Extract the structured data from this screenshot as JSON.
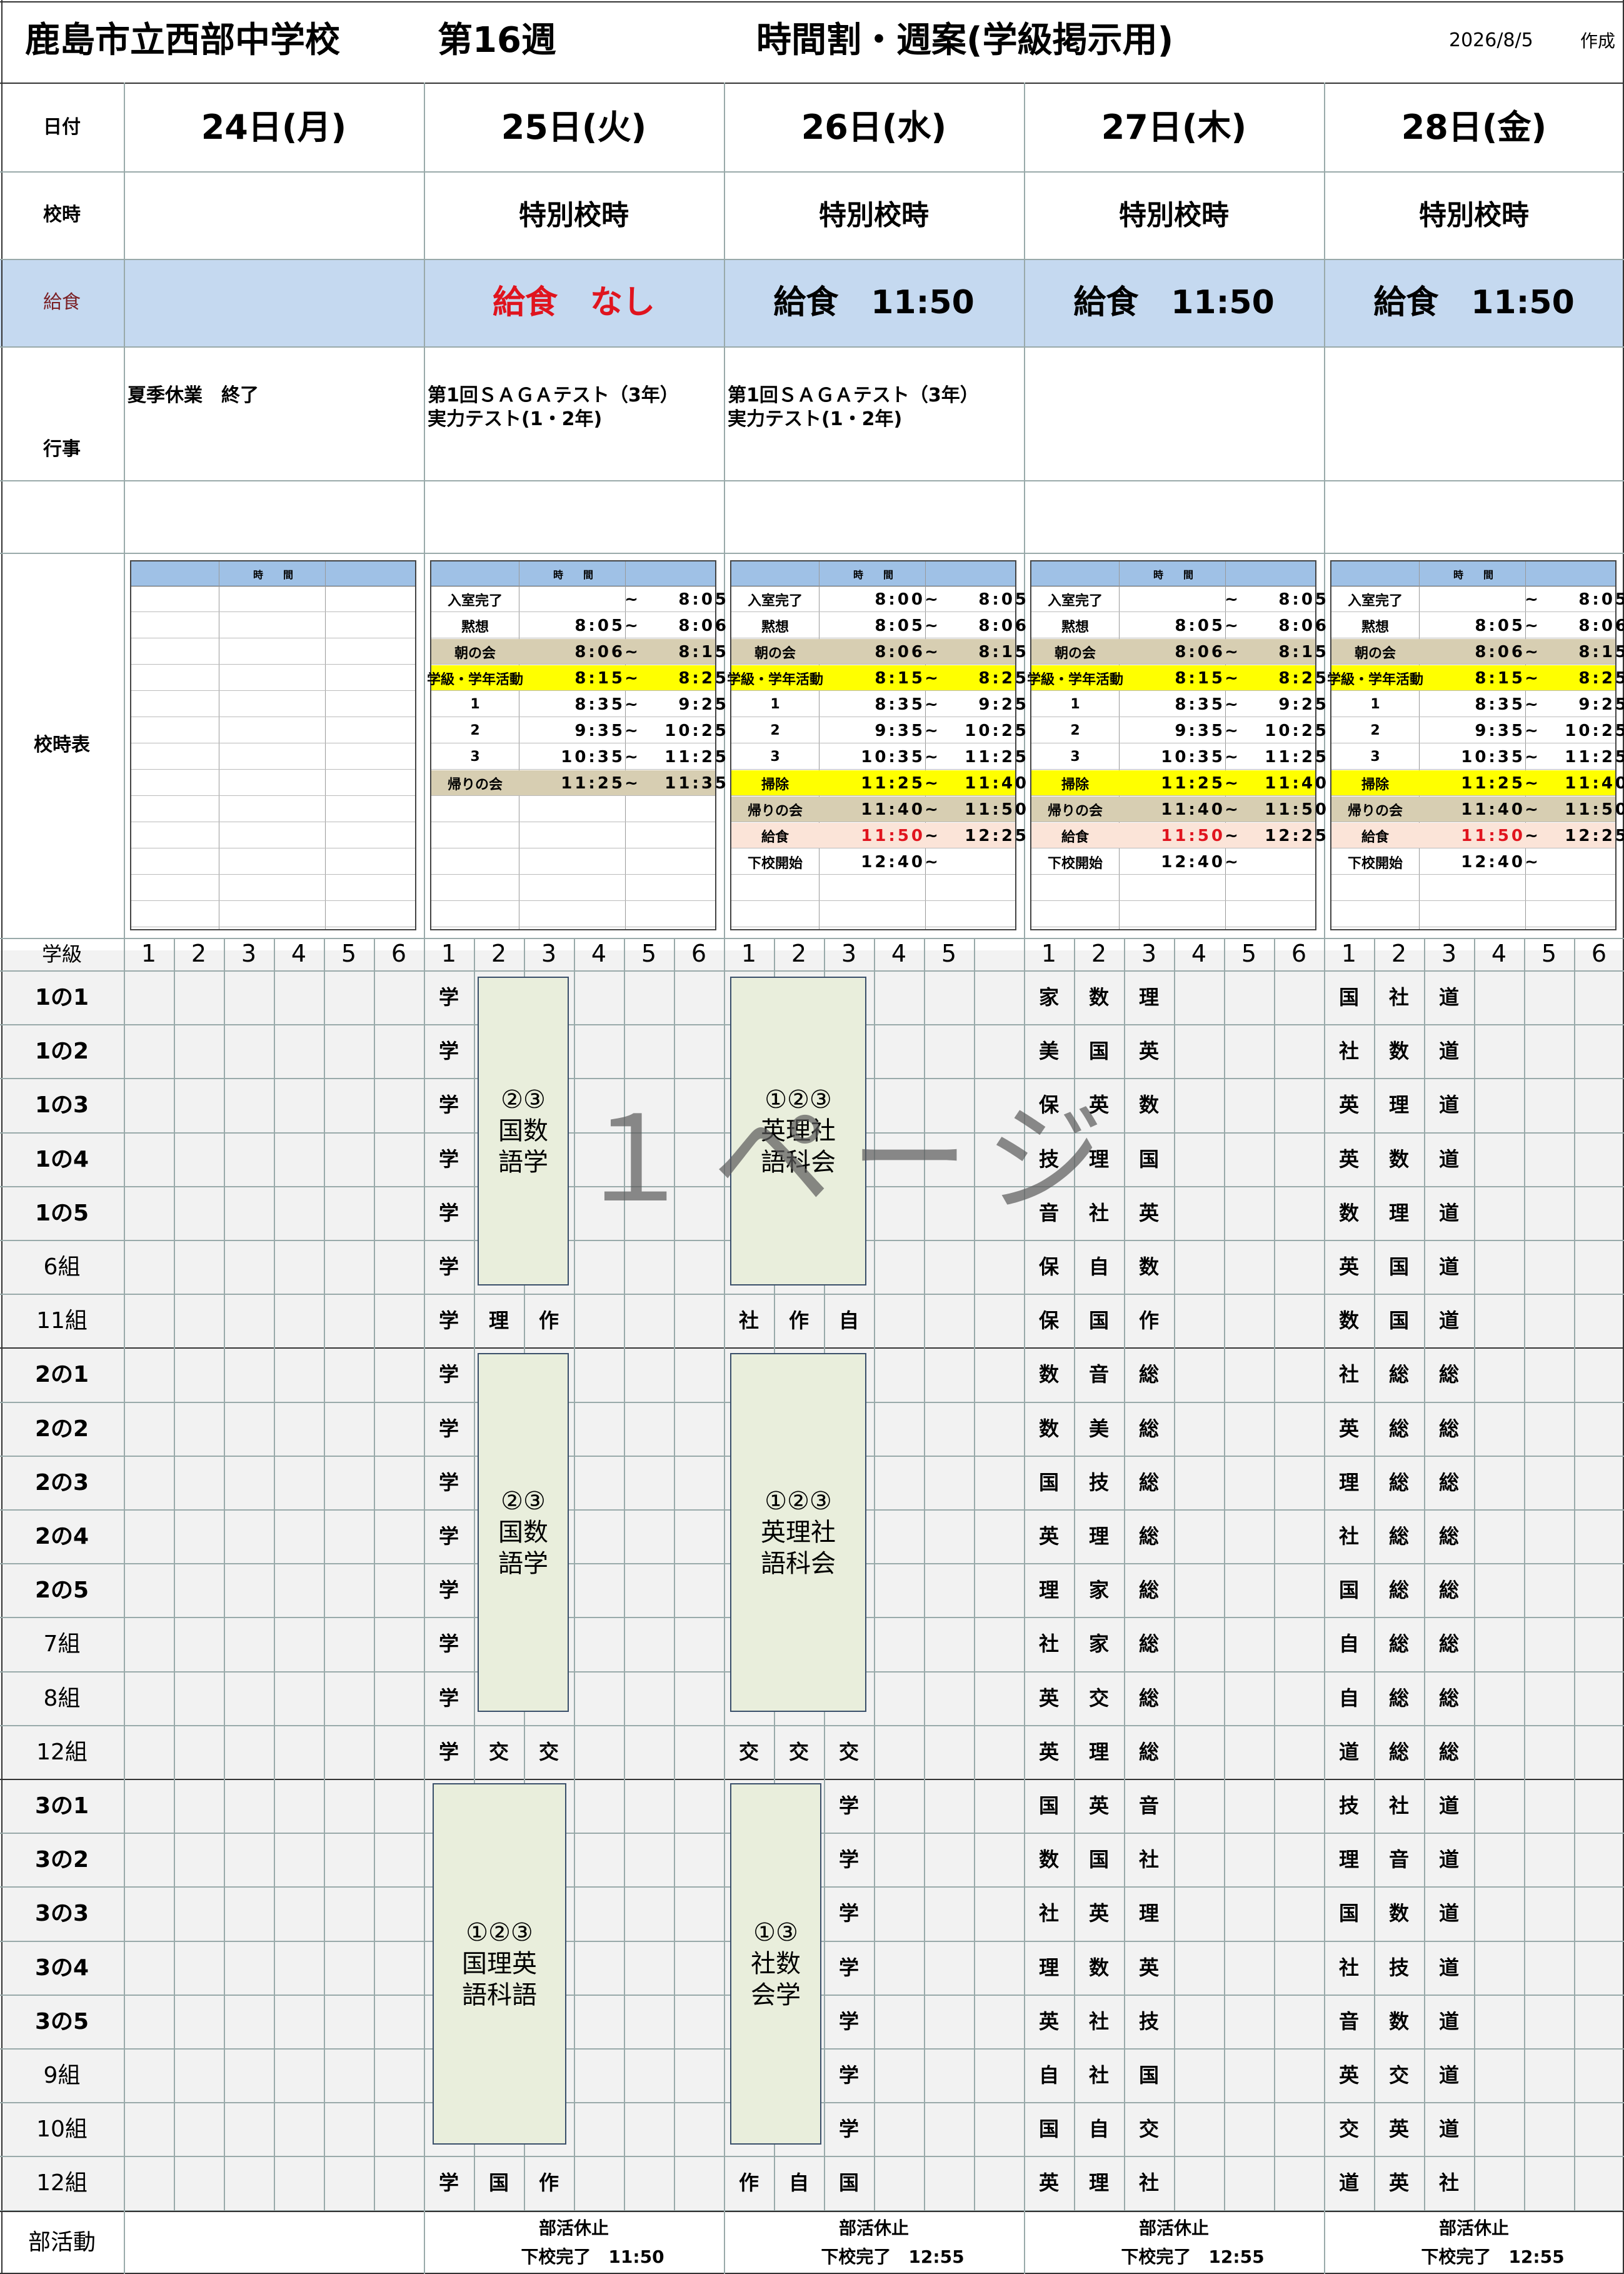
{
  "header": {
    "school": "鹿島市立西部中学校",
    "week": "第16週",
    "title": "時間割・週案(学級掲示用)",
    "date": "2026/8/5",
    "made": "作成"
  },
  "labels": {
    "date": "日付",
    "schedule": "校時",
    "lunch": "給食",
    "events": "行事",
    "bell": "校時表",
    "grade": "学級",
    "club": "部活動"
  },
  "days": [
    {
      "date": "24日(月)",
      "schedule": "",
      "lunch": "",
      "events": "夏季休業　終了"
    },
    {
      "date": "25日(火)",
      "schedule": "特別校時",
      "lunch": "給食　なし",
      "events": "第1回ＳＡＧＡテスト（3年）\n実力テスト(1・2年)"
    },
    {
      "date": "26日(水)",
      "schedule": "特別校時",
      "lunch": "給食　11:50",
      "events": "第1回ＳＡＧＡテスト（3年）\n実力テスト(1・2年)"
    },
    {
      "date": "27日(木)",
      "schedule": "特別校時",
      "lunch": "給食　11:50",
      "events": ""
    },
    {
      "date": "28日(金)",
      "schedule": "特別校時",
      "lunch": "給食　11:50",
      "events": ""
    }
  ],
  "bell_header": "時　　間",
  "bell_tables": [
    null,
    [
      [
        "入室完了",
        "",
        "8:05",
        ""
      ],
      [
        "黙想",
        "8:05",
        "8:06",
        ""
      ],
      [
        "朝の会",
        "8:06",
        "8:15",
        "tan"
      ],
      [
        "学級・学年活動",
        "8:15",
        "8:25",
        "yel"
      ],
      [
        "1",
        "8:35",
        "9:25",
        ""
      ],
      [
        "2",
        "9:35",
        "10:25",
        ""
      ],
      [
        "3",
        "10:35",
        "11:25",
        ""
      ],
      [
        "帰りの会",
        "11:25",
        "11:35",
        "tan"
      ]
    ],
    [
      [
        "入室完了",
        "8:00",
        "8:05",
        ""
      ],
      [
        "黙想",
        "8:05",
        "8:06",
        ""
      ],
      [
        "朝の会",
        "8:06",
        "8:15",
        "tan"
      ],
      [
        "学級・学年活動",
        "8:15",
        "8:25",
        "yel"
      ],
      [
        "1",
        "8:35",
        "9:25",
        ""
      ],
      [
        "2",
        "9:35",
        "10:25",
        ""
      ],
      [
        "3",
        "10:35",
        "11:25",
        ""
      ],
      [
        "掃除",
        "11:25",
        "11:40",
        "yel"
      ],
      [
        "帰りの会",
        "11:40",
        "11:50",
        "tan"
      ],
      [
        "給食",
        "11:50",
        "12:25",
        "pink"
      ],
      [
        "下校開始",
        "12:40",
        "",
        ""
      ]
    ],
    [
      [
        "入室完了",
        "",
        "8:05",
        ""
      ],
      [
        "黙想",
        "8:05",
        "8:06",
        ""
      ],
      [
        "朝の会",
        "8:06",
        "8:15",
        "tan"
      ],
      [
        "学級・学年活動",
        "8:15",
        "8:25",
        "yel"
      ],
      [
        "1",
        "8:35",
        "9:25",
        ""
      ],
      [
        "2",
        "9:35",
        "10:25",
        ""
      ],
      [
        "3",
        "10:35",
        "11:25",
        ""
      ],
      [
        "掃除",
        "11:25",
        "11:40",
        "yel"
      ],
      [
        "帰りの会",
        "11:40",
        "11:50",
        "tan"
      ],
      [
        "給食",
        "11:50",
        "12:25",
        "pink"
      ],
      [
        "下校開始",
        "12:40",
        "",
        ""
      ]
    ],
    [
      [
        "入室完了",
        "",
        "8:05",
        ""
      ],
      [
        "黙想",
        "8:05",
        "8:06",
        ""
      ],
      [
        "朝の会",
        "8:06",
        "8:15",
        "tan"
      ],
      [
        "学級・学年活動",
        "8:15",
        "8:25",
        "yel"
      ],
      [
        "1",
        "8:35",
        "9:25",
        ""
      ],
      [
        "2",
        "9:35",
        "10:25",
        ""
      ],
      [
        "3",
        "10:35",
        "11:25",
        ""
      ],
      [
        "掃除",
        "11:25",
        "11:40",
        "yel"
      ],
      [
        "帰りの会",
        "11:40",
        "11:50",
        "tan"
      ],
      [
        "給食",
        "11:50",
        "12:25",
        "pink"
      ],
      [
        "下校開始",
        "12:40",
        "",
        ""
      ]
    ]
  ],
  "periods": [
    [
      "1",
      "2",
      "3",
      "4",
      "5",
      "6"
    ],
    [
      "1",
      "2",
      "3",
      "4",
      "5",
      "6"
    ],
    [
      "1",
      "2",
      "3",
      "4",
      "5"
    ],
    [
      "1",
      "2",
      "3",
      "4",
      "5",
      "6"
    ],
    [
      "1",
      "2",
      "3",
      "4",
      "5",
      "6"
    ]
  ],
  "classes": [
    {
      "name": "1の1",
      "tue": "学",
      "thu": [
        "家",
        "数",
        "理"
      ],
      "fri": [
        "国",
        "社",
        "道"
      ]
    },
    {
      "name": "1の2",
      "tue": "学",
      "thu": [
        "美",
        "国",
        "英"
      ],
      "fri": [
        "社",
        "数",
        "道"
      ]
    },
    {
      "name": "1の3",
      "tue": "学",
      "thu": [
        "保",
        "英",
        "数"
      ],
      "fri": [
        "英",
        "理",
        "道"
      ]
    },
    {
      "name": "1の4",
      "tue": "学",
      "thu": [
        "技",
        "理",
        "国"
      ],
      "fri": [
        "英",
        "数",
        "道"
      ]
    },
    {
      "name": "1の5",
      "tue": "学",
      "thu": [
        "音",
        "社",
        "英"
      ],
      "fri": [
        "数",
        "理",
        "道"
      ]
    },
    {
      "name": "6組",
      "tue": "学",
      "thu": [
        "保",
        "自",
        "数"
      ],
      "fri": [
        "英",
        "国",
        "道"
      ]
    },
    {
      "name": "11組",
      "tue3": [
        "学",
        "理",
        "作"
      ],
      "wed3": [
        "社",
        "作",
        "自"
      ],
      "thu": [
        "保",
        "国",
        "作"
      ],
      "fri": [
        "数",
        "国",
        "道"
      ]
    },
    {
      "name": "2の1",
      "tue": "学",
      "thu": [
        "数",
        "音",
        "総"
      ],
      "fri": [
        "社",
        "総",
        "総"
      ]
    },
    {
      "name": "2の2",
      "tue": "学",
      "thu": [
        "数",
        "美",
        "総"
      ],
      "fri": [
        "英",
        "総",
        "総"
      ]
    },
    {
      "name": "2の3",
      "tue": "学",
      "thu": [
        "国",
        "技",
        "総"
      ],
      "fri": [
        "理",
        "総",
        "総"
      ]
    },
    {
      "name": "2の4",
      "tue": "学",
      "thu": [
        "英",
        "理",
        "総"
      ],
      "fri": [
        "社",
        "総",
        "総"
      ]
    },
    {
      "name": "2の5",
      "tue": "学",
      "thu": [
        "理",
        "家",
        "総"
      ],
      "fri": [
        "国",
        "総",
        "総"
      ]
    },
    {
      "name": "7組",
      "tue": "学",
      "thu": [
        "社",
        "家",
        "総"
      ],
      "fri": [
        "自",
        "総",
        "総"
      ]
    },
    {
      "name": "8組",
      "tue": "学",
      "thu": [
        "英",
        "交",
        "総"
      ],
      "fri": [
        "自",
        "総",
        "総"
      ]
    },
    {
      "name": "12組",
      "tue3": [
        "学",
        "交",
        "交"
      ],
      "wed3": [
        "交",
        "交",
        "交"
      ],
      "thu": [
        "英",
        "理",
        "総"
      ],
      "fri": [
        "道",
        "総",
        "総"
      ]
    },
    {
      "name": "3の1",
      "wed": "学",
      "thu": [
        "国",
        "英",
        "音"
      ],
      "fri": [
        "技",
        "社",
        "道"
      ]
    },
    {
      "name": "3の2",
      "wed": "学",
      "thu": [
        "数",
        "国",
        "社"
      ],
      "fri": [
        "理",
        "音",
        "道"
      ]
    },
    {
      "name": "3の3",
      "wed": "学",
      "thu": [
        "社",
        "英",
        "理"
      ],
      "fri": [
        "国",
        "数",
        "道"
      ]
    },
    {
      "name": "3の4",
      "wed": "学",
      "thu": [
        "理",
        "数",
        "英"
      ],
      "fri": [
        "社",
        "技",
        "道"
      ]
    },
    {
      "name": "3の5",
      "wed": "学",
      "thu": [
        "英",
        "社",
        "技"
      ],
      "fri": [
        "音",
        "数",
        "道"
      ]
    },
    {
      "name": "9組",
      "wed": "学",
      "thu": [
        "自",
        "社",
        "国"
      ],
      "fri": [
        "英",
        "交",
        "道"
      ]
    },
    {
      "name": "10組",
      "wed": "学",
      "thu": [
        "国",
        "自",
        "交"
      ],
      "fri": [
        "交",
        "英",
        "道"
      ]
    },
    {
      "name": "12組",
      "tue3": [
        "学",
        "国",
        "作"
      ],
      "wed3": [
        "作",
        "自",
        "国"
      ],
      "thu": [
        "英",
        "理",
        "社"
      ],
      "fri": [
        "道",
        "英",
        "社"
      ]
    }
  ],
  "blocks": {
    "g1_tue": "②③\n国数\n語学",
    "g1_wed": "①②③\n英理社\n語科会",
    "g2_tue": "②③\n国数\n語学",
    "g2_wed": "①②③\n英理社\n語科会",
    "g3_tue": "①②③\n国理英\n語科語",
    "g3_wed": "①③\n社数\n会学"
  },
  "watermark": "１ページ",
  "club": [
    {
      "l1": "",
      "l2": ""
    },
    {
      "l1": "部活休止",
      "l2": "下校完了　11:50"
    },
    {
      "l1": "部活休止",
      "l2": "下校完了　12:55"
    },
    {
      "l1": "部活休止",
      "l2": "下校完了　12:55"
    },
    {
      "l1": "部活休止",
      "l2": "下校完了　12:55"
    }
  ],
  "colors": {
    "lunch_band": "#c5d9f0",
    "red": "#e0141e",
    "yellow": "#ffff00",
    "tan": "#d7ceb2",
    "pink": "#fbe4d8",
    "block": "#e9eedc"
  }
}
